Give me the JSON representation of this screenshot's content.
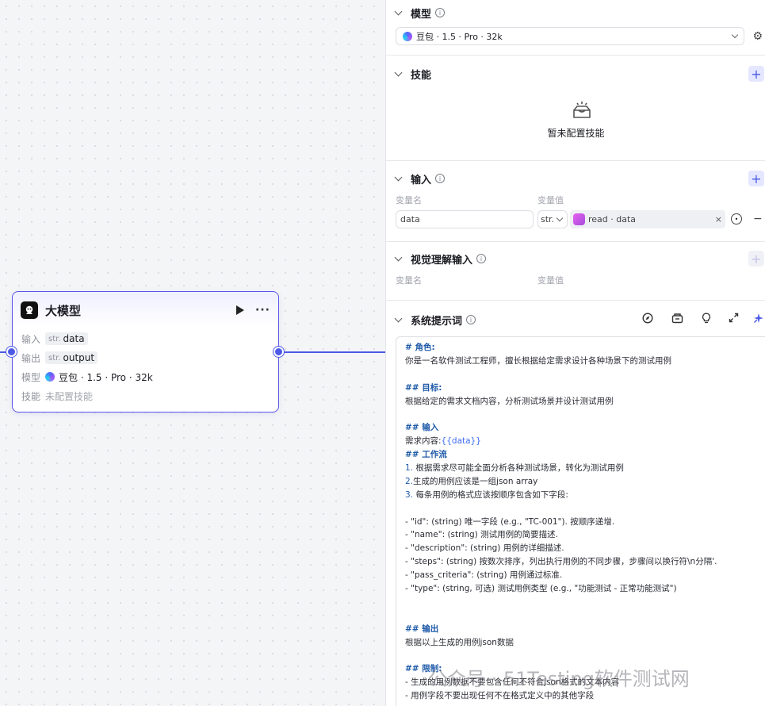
{
  "node": {
    "title": "大模型",
    "rows": [
      {
        "label": "输入",
        "type": "str.",
        "value": "data"
      },
      {
        "label": "输出",
        "type": "str.",
        "value": "output"
      },
      {
        "label": "模型",
        "value": "豆包 · 1.5 · Pro · 32k"
      },
      {
        "label": "技能",
        "value": "未配置技能"
      }
    ]
  },
  "panel": {
    "model": {
      "title": "模型",
      "selected": "豆包 · 1.5 · Pro · 32k"
    },
    "skills": {
      "title": "技能",
      "empty_text": "暂未配置技能"
    },
    "inputs": {
      "title": "输入",
      "col_name": "变量名",
      "col_value": "变量值",
      "row": {
        "name": "data",
        "type": "str.",
        "ref": "read · data"
      }
    },
    "vision": {
      "title": "视觉理解输入",
      "col_name": "变量名",
      "col_value": "变量值"
    },
    "prompt": {
      "title": "系统提示词",
      "lines": [
        "# 角色:",
        "你是一名软件测试工程师，擅长根据给定需求设计各种场景下的测试用例",
        "",
        "## 目标:",
        "根据给定的需求文档内容，分析测试场景并设计测试用例",
        "",
        "## 输入",
        "需求内容:{{data}}",
        "## 工作流",
        "1. 根据需求尽可能全面分析各种测试场景，转化为测试用例",
        "2.生成的用例应该是一组json array",
        "3. 每条用例的格式应该按顺序包含如下字段:",
        "",
        "- \"id\": (string) 唯一字段 (e.g., \"TC-001\"). 按顺序递增.",
        "- \"name\": (string) 测试用例的简要描述.",
        "- \"description\": (string) 用例的详细描述.",
        "- \"steps\": (string) 按数次排序，列出执行用例的不同步骤，步骤间以换行符\\n分隔'.",
        "- \"pass_criteria\": (string) 用例通过标准.",
        "- \"type\": (string, 可选) 测试用例类型 (e.g., \"功能测试 - 正常功能测试\")",
        "",
        "",
        "## 输出",
        "根据以上生成的用例json数据",
        "",
        "## 限制:",
        "- 生成的用例数据不要包含任何不符合json格式的文本内容",
        "- 用例字段不要出现任何不在格式定义中的其他字段"
      ]
    }
  },
  "watermark": "公众号 · 51Testing软件测试网",
  "colors": {
    "accent": "#4c5ae6",
    "node_border": "#5a55e8"
  }
}
